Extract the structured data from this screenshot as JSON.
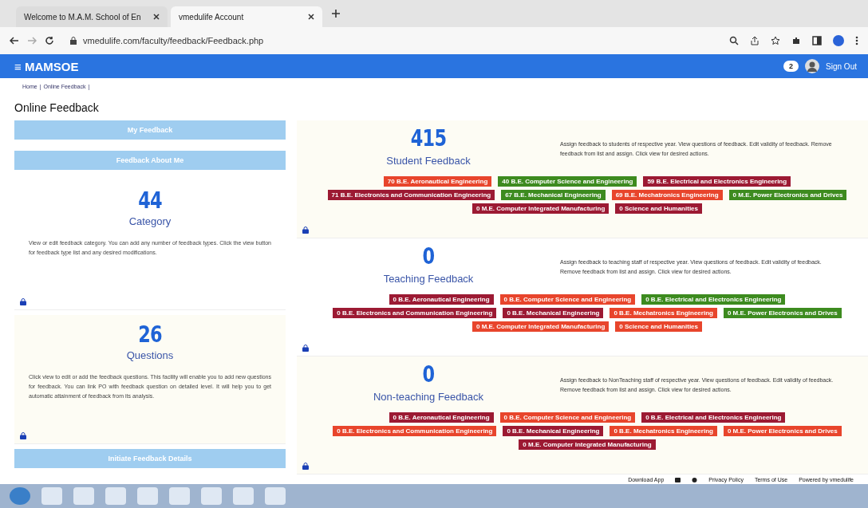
{
  "browser": {
    "tabs": [
      {
        "title": "Welcome to M.A.M. School of En",
        "selected": false
      },
      {
        "title": "vmedulife Account",
        "selected": true
      }
    ],
    "url": "vmedulife.com/faculty/feedback/Feedback.php"
  },
  "header": {
    "menu_glyph": "≡",
    "brand": "MAMSOE",
    "badge": "2",
    "sign_out": "Sign Out"
  },
  "breadcrumb": [
    {
      "text": "Home",
      "separator": "|"
    },
    {
      "text": "Online Feedback",
      "separator": "|"
    }
  ],
  "page_title": "Online Feedback",
  "sidebar": {
    "buttons_top": [
      "My Feedback",
      "Feedback About Me"
    ],
    "cards": [
      {
        "count": "44",
        "label": "Category",
        "text": "View or edit feedback category. You can add any number of feedback types. Click the view button for feedback type list and any desired modifications."
      },
      {
        "count": "26",
        "label": "Questions",
        "text": "Click view to edit or add the feedback questions. This facility will enable you to add new questions for feedback. You can link PO with feedback question on detailed level. It will help you to get automatic attainment of feedback from its analysis."
      }
    ],
    "buttons_bottom": [
      "Initiate Feedback Details"
    ]
  },
  "sections": [
    {
      "count": "415",
      "label": "Student Feedback",
      "text": "Assign feedback to students of respective year. View questions of feedback. Edit validity of feedback. Remove feedback from list and assign. Click view for desired actions.",
      "tags": [
        {
          "text": "70 B.E. Aeronautical Engineering",
          "color": "#e8452c"
        },
        {
          "text": "40 B.E. Computer Science and Engineering",
          "color": "#3d8b1f"
        },
        {
          "text": "59 B.E. Electrical and Electronics Engineering",
          "color": "#9c1a33"
        },
        {
          "text": "71 B.E. Electronics and Communication Engineering",
          "color": "#9c1a33"
        },
        {
          "text": "67 B.E. Mechanical Engineering",
          "color": "#3d8b1f"
        },
        {
          "text": "69 B.E. Mechatronics Engineering",
          "color": "#e8452c"
        },
        {
          "text": "0 M.E. Power Electronics and Drives",
          "color": "#3d8b1f"
        },
        {
          "text": "0 M.E. Computer Integrated Manufacturing",
          "color": "#9c1a33"
        },
        {
          "text": "0 Science and Humanities",
          "color": "#9c1a33"
        }
      ]
    },
    {
      "count": "0",
      "label": "Teaching Feedback",
      "text": "Assign feedback to teaching staff of respective year. View questions of feedback. Edit validity of feedback. Remove feedback from list and assign. Click view for desired actions.",
      "tags": [
        {
          "text": "0 B.E. Aeronautical Engineering",
          "color": "#9c1a33"
        },
        {
          "text": "0 B.E. Computer Science and Engineering",
          "color": "#e8452c"
        },
        {
          "text": "0 B.E. Electrical and Electronics Engineering",
          "color": "#3d8b1f"
        },
        {
          "text": "0 B.E. Electronics and Communication Engineering",
          "color": "#9c1a33"
        },
        {
          "text": "0 B.E. Mechanical Engineering",
          "color": "#9c1a33"
        },
        {
          "text": "0 B.E. Mechatronics Engineering",
          "color": "#e8452c"
        },
        {
          "text": "0 M.E. Power Electronics and Drives",
          "color": "#3d8b1f"
        },
        {
          "text": "0 M.E. Computer Integrated Manufacturing",
          "color": "#e8452c"
        },
        {
          "text": "0 Science and Humanities",
          "color": "#e8452c"
        }
      ]
    },
    {
      "count": "0",
      "label": "Non-teaching Feedback",
      "text": "Assign feedback to NonTeaching staff of respective year. View questions of feedback. Edit validity of feedback. Remove feedback from list and assign. Click view for desired actions.",
      "tags": [
        {
          "text": "0 B.E. Aeronautical Engineering",
          "color": "#9c1a33"
        },
        {
          "text": "0 B.E. Computer Science and Engineering",
          "color": "#e8452c"
        },
        {
          "text": "0 B.E. Electrical and Electronics Engineering",
          "color": "#9c1a33"
        },
        {
          "text": "0 B.E. Electronics and Communication Engineering",
          "color": "#e8452c"
        },
        {
          "text": "0 B.E. Mechanical Engineering",
          "color": "#9c1a33"
        },
        {
          "text": "0 B.E. Mechatronics Engineering",
          "color": "#e8452c"
        },
        {
          "text": "0 M.E. Power Electronics and Drives",
          "color": "#e8452c"
        },
        {
          "text": "0 M.E. Computer Integrated Manufacturing",
          "color": "#9c1a33"
        }
      ]
    }
  ],
  "footer": {
    "download": "Download App",
    "links": [
      "Privacy Policy",
      "Terms of Use"
    ],
    "powered": "Powered by vmedulife"
  }
}
